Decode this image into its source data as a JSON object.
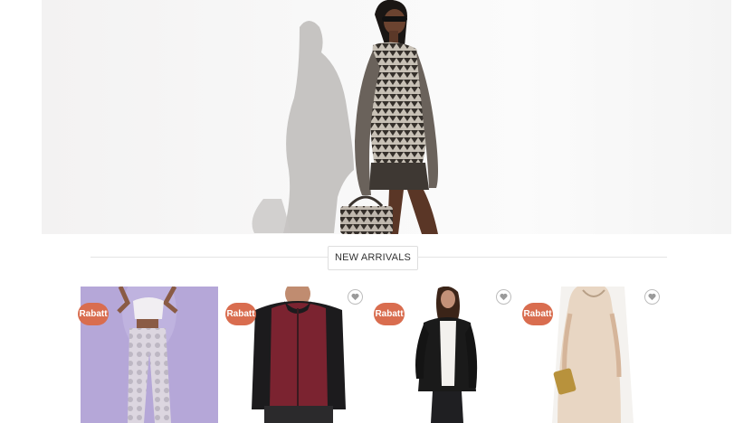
{
  "section": {
    "title": "NEW ARRIVALS"
  },
  "products": [
    {
      "badge": "Rabatt"
    },
    {
      "badge": "Rabatt"
    },
    {
      "badge": "Rabatt"
    },
    {
      "badge": "Rabatt"
    }
  ],
  "colors": {
    "badge": "#d96d4f",
    "hero_bg": "#f6f6f6"
  }
}
